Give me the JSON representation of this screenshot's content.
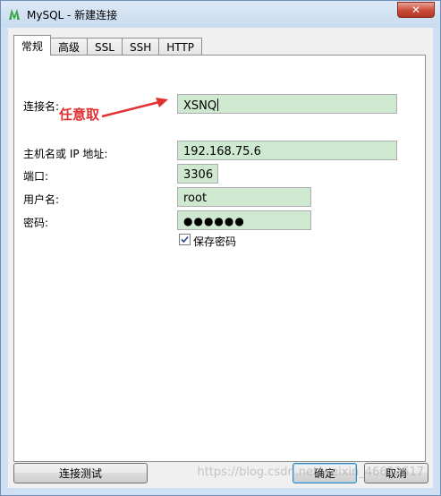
{
  "window": {
    "title": "MySQL - 新建连接",
    "close_glyph": "✕"
  },
  "tabs": [
    {
      "label": "常规",
      "active": true
    },
    {
      "label": "高级",
      "active": false
    },
    {
      "label": "SSL",
      "active": false
    },
    {
      "label": "SSH",
      "active": false
    },
    {
      "label": "HTTP",
      "active": false
    }
  ],
  "form": {
    "connection_name_label": "连接名:",
    "connection_name_value": "XSNQ",
    "host_label": "主机名或 IP 地址:",
    "host_value": "192.168.75.6",
    "port_label": "端口:",
    "port_value": "3306",
    "user_label": "用户名:",
    "user_value": "root",
    "password_label": "密码:",
    "password_value": "●●●●●●",
    "save_password_label": "保存密码",
    "save_password_checked": true
  },
  "annotation": {
    "text": "任意取",
    "color": "#e03131"
  },
  "buttons": {
    "test_connection": "连接测试",
    "ok": "确定",
    "cancel": "取消"
  },
  "watermark": "https://blog.csdn.net/weixin_46622617",
  "colors": {
    "field_bg": "#cfe9d1",
    "frame": "#cfe0f3",
    "close_red": "#c94b38"
  },
  "icons": {
    "app": "mysql-dolphin-icon",
    "checkbox": "checkmark-icon"
  }
}
